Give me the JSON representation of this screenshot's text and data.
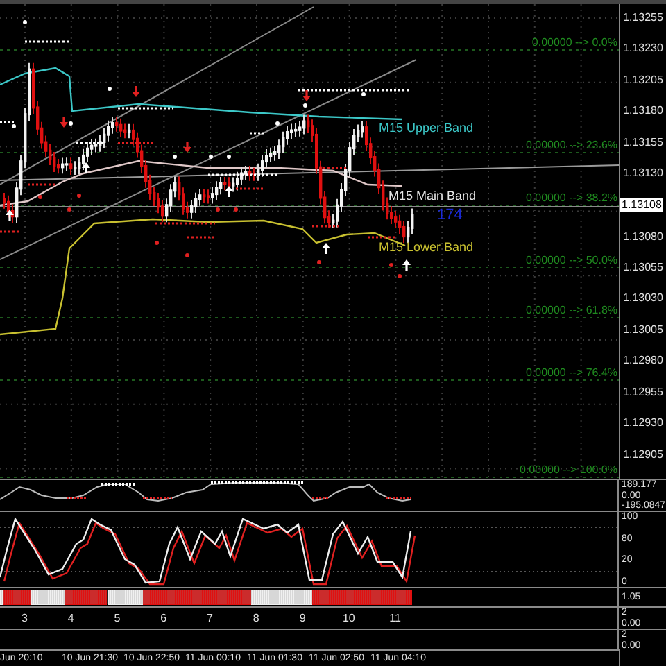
{
  "price_axis": [
    {
      "text": "1.13255",
      "kind": "tick"
    },
    {
      "text": "1.13230",
      "kind": "tick"
    },
    {
      "text": "1.13205",
      "kind": "tick"
    },
    {
      "text": "1.13180",
      "kind": "tick"
    },
    {
      "text": "1.13155",
      "kind": "tick"
    },
    {
      "text": "1.13130",
      "kind": "tick"
    },
    {
      "text": "1.13108",
      "kind": "current"
    },
    {
      "text": "1.13080",
      "kind": "tick"
    },
    {
      "text": "1.13055",
      "kind": "tick"
    },
    {
      "text": "1.13030",
      "kind": "tick"
    },
    {
      "text": "1.13005",
      "kind": "tick"
    },
    {
      "text": "1.12980",
      "kind": "tick"
    },
    {
      "text": "1.12955",
      "kind": "tick"
    },
    {
      "text": "1.12930",
      "kind": "tick"
    },
    {
      "text": "1.12905",
      "kind": "tick"
    }
  ],
  "fib_levels": [
    "0.00000 --> 0.0%",
    "0.00000 --> 23.6%",
    "0.00000 --> 38.2%",
    "0.00000 --> 50.0%",
    "0.00000 --> 61.8%",
    "0.00000 --> 76.4%",
    "0.00000 --> 100.0%"
  ],
  "bands": [
    {
      "text": "M15 Upper Band",
      "color": "#3cc8c8"
    },
    {
      "text": "M15 Main Band",
      "color": "#e8e8e8"
    },
    {
      "text": "M15 Lower Band",
      "color": "#c8c030"
    }
  ],
  "bar_count": "174",
  "panels": [
    {
      "kind": "cci",
      "scale": [
        "189.177",
        "0.00",
        "-195.0847"
      ]
    },
    {
      "kind": "stochastic",
      "scale": [
        "100",
        "80",
        "20",
        "0"
      ]
    },
    {
      "kind": "signal_bar",
      "scale": [
        "1.05"
      ]
    },
    {
      "kind": "numbers",
      "numbers": [
        "3",
        "4",
        "5",
        "6",
        "7",
        "8",
        "9",
        "10",
        "11"
      ],
      "scale": [
        "2",
        "0.00"
      ]
    },
    {
      "kind": "empty",
      "scale": [
        "2",
        "0.00"
      ]
    }
  ],
  "time_axis": [
    "Jun 20:10",
    "10 Jun 21:30",
    "10 Jun 22:50",
    "11 Jun 00:10",
    "11 Jun 01:30",
    "11 Jun 02:50",
    "11 Jun 04:10"
  ]
}
